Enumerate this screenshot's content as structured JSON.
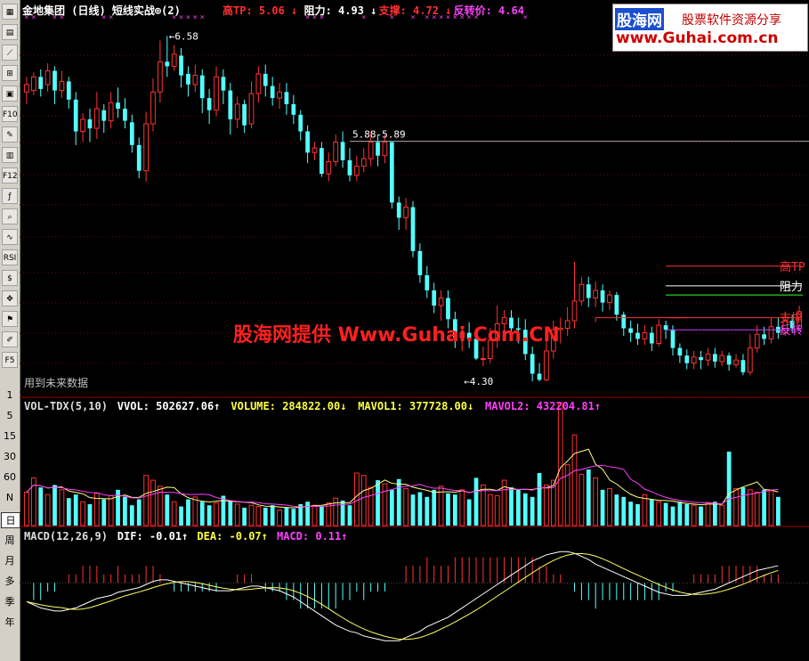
{
  "header": {
    "title": "金地集团 (日线) 短线实战⊕(2)",
    "items": [
      {
        "label": "高TP: 5.06 ↓",
        "color": "#ff3030"
      },
      {
        "label": "阻力: 4.93 ↓",
        "color": "#ffffff"
      },
      {
        "label": "支撑: 4.72 ↓",
        "color": "#ff3030"
      },
      {
        "label": "反转价: 4.64",
        "color": "#ff40ff"
      }
    ]
  },
  "logo": {
    "brand": "股海网",
    "slogan": "股票软件资源分享",
    "url": "www.Guhai.com.cn"
  },
  "watermark": "股海网提供 Www.Guhai.Com.CN",
  "notice": "用到未来数据",
  "price_panel": {
    "annotations": {
      "high": "6.58",
      "range": "5.88-5.89",
      "low": "←4.30"
    },
    "right_labels": {
      "high_tp": "高TP",
      "resistance": "阻力",
      "support": "支撑",
      "reversal": "反转"
    }
  },
  "volume_panel": {
    "header_items": [
      {
        "label": "VOL-TDX(5,10)",
        "color": "#dddddd"
      },
      {
        "label": "VVOL: 502627.06↑",
        "color": "#ffffff"
      },
      {
        "label": "VOLUME: 284822.00↓",
        "color": "#ffff40"
      },
      {
        "label": "MAVOL1: 377728.00↓",
        "color": "#ffff40"
      },
      {
        "label": "MAVOL2: 432204.81↑",
        "color": "#ff40ff"
      }
    ]
  },
  "macd_panel": {
    "header_items": [
      {
        "label": "MACD(12,26,9)",
        "color": "#dddddd"
      },
      {
        "label": "DIF: -0.01↑",
        "color": "#ffffff"
      },
      {
        "label": "DEA: -0.07↑",
        "color": "#ffff40"
      },
      {
        "label": "MACD: 0.11↑",
        "color": "#ff40ff"
      }
    ]
  },
  "toolbar": {
    "icons": [
      "grid-icon",
      "table-icon",
      "line-chart-icon",
      "candle-icon",
      "window-icon",
      "f10-icon",
      "pen-icon",
      "sheet-icon",
      "f12-icon",
      "fx-icon",
      "search-icon",
      "wave-icon",
      "rsi-icon",
      "dollar-icon",
      "move-icon",
      "flag-icon",
      "pencil-icon",
      "f5-icon"
    ],
    "labels": {
      "rsi": "RSI",
      "f10": "F10",
      "f12": "F12",
      "f5": "F5"
    },
    "periods": [
      "1",
      "5",
      "15",
      "30",
      "60",
      "N",
      "日",
      "周",
      "月",
      "多",
      "季",
      "年"
    ]
  },
  "colors": {
    "up": "#ff3232",
    "down": "#54ffff",
    "background": "#000000"
  },
  "chart_data": [
    {
      "type": "candlestick",
      "ylim": [
        4.2,
        6.7
      ],
      "annotated_high": 6.58,
      "annotated_low": 4.3,
      "levels": {
        "high_tp": 5.06,
        "resistance": 4.93,
        "support": 4.72,
        "reversal": 4.64
      },
      "candles": [
        [
          6.21,
          6.26,
          6.31,
          6.13
        ],
        [
          6.22,
          6.31,
          6.34,
          6.19
        ],
        [
          6.31,
          6.23,
          6.36,
          6.18
        ],
        [
          6.26,
          6.35,
          6.4,
          6.21
        ],
        [
          6.35,
          6.22,
          6.38,
          6.13
        ],
        [
          6.22,
          6.28,
          6.35,
          6.17
        ],
        [
          6.28,
          6.16,
          6.31,
          6.1
        ],
        [
          6.16,
          5.95,
          6.21,
          5.86
        ],
        [
          5.95,
          6.03,
          6.07,
          5.88
        ],
        [
          6.03,
          5.97,
          6.1,
          5.88
        ],
        [
          5.97,
          6.1,
          6.21,
          5.9
        ],
        [
          6.09,
          6.02,
          6.13,
          5.94
        ],
        [
          6.02,
          6.14,
          6.21,
          5.97
        ],
        [
          6.14,
          6.1,
          6.24,
          6.04
        ],
        [
          6.1,
          6.02,
          6.17,
          5.97
        ],
        [
          6.01,
          5.86,
          6.06,
          5.81
        ],
        [
          5.86,
          5.69,
          5.91,
          5.64
        ],
        [
          5.69,
          6.0,
          6.08,
          5.62
        ],
        [
          6.0,
          6.21,
          6.3,
          5.95
        ],
        [
          6.21,
          6.41,
          6.55,
          6.14
        ],
        [
          6.41,
          6.38,
          6.58,
          6.31
        ],
        [
          6.38,
          6.46,
          6.52,
          6.35
        ],
        [
          6.45,
          6.32,
          6.5,
          6.24
        ],
        [
          6.33,
          6.26,
          6.38,
          6.18
        ],
        [
          6.26,
          6.32,
          6.39,
          6.21
        ],
        [
          6.32,
          6.17,
          6.36,
          6.07
        ],
        [
          6.17,
          6.09,
          6.23,
          6.0
        ],
        [
          6.09,
          6.31,
          6.38,
          6.05
        ],
        [
          6.31,
          6.22,
          6.36,
          6.13
        ],
        [
          6.22,
          6.03,
          6.27,
          5.93
        ],
        [
          6.03,
          6.13,
          6.18,
          5.97
        ],
        [
          6.13,
          5.99,
          6.16,
          5.94
        ],
        [
          6.0,
          6.2,
          6.28,
          5.97
        ],
        [
          6.2,
          6.33,
          6.38,
          6.14
        ],
        [
          6.33,
          6.25,
          6.39,
          6.18
        ],
        [
          6.25,
          6.17,
          6.31,
          6.12
        ],
        [
          6.17,
          6.21,
          6.27,
          6.1
        ],
        [
          6.21,
          6.13,
          6.27,
          6.06
        ],
        [
          6.13,
          6.06,
          6.19,
          6.0
        ],
        [
          6.06,
          5.95,
          6.09,
          5.89
        ],
        [
          5.95,
          5.81,
          5.99,
          5.74
        ],
        [
          5.81,
          5.84,
          5.88,
          5.76
        ],
        [
          5.84,
          5.67,
          5.88,
          5.65
        ],
        [
          5.67,
          5.75,
          5.81,
          5.62
        ],
        [
          5.75,
          5.88,
          5.93,
          5.72
        ],
        [
          5.88,
          5.76,
          5.95,
          5.71
        ],
        [
          5.76,
          5.66,
          5.84,
          5.62
        ],
        [
          5.66,
          5.72,
          5.79,
          5.62
        ],
        [
          5.72,
          5.77,
          5.84,
          5.68
        ],
        [
          5.77,
          5.88,
          5.95,
          5.72
        ],
        [
          5.88,
          5.79,
          5.93,
          5.72
        ],
        [
          5.79,
          5.88,
          5.93,
          5.74
        ],
        [
          5.88,
          5.48,
          5.88,
          5.44
        ],
        [
          5.48,
          5.38,
          5.52,
          5.3
        ],
        [
          5.38,
          5.45,
          5.51,
          5.3
        ],
        [
          5.45,
          5.16,
          5.49,
          5.12
        ],
        [
          5.16,
          5.0,
          5.21,
          4.95
        ],
        [
          5.0,
          4.9,
          5.06,
          4.85
        ],
        [
          4.9,
          4.8,
          4.95,
          4.75
        ],
        [
          4.8,
          4.85,
          4.9,
          4.7
        ],
        [
          4.85,
          4.71,
          4.9,
          4.65
        ],
        [
          4.71,
          4.59,
          4.76,
          4.52
        ],
        [
          4.59,
          4.62,
          4.65,
          4.5
        ],
        [
          4.62,
          4.58,
          4.69,
          4.52
        ],
        [
          4.58,
          4.45,
          4.63,
          4.44
        ],
        [
          4.45,
          4.45,
          4.53,
          4.4
        ],
        [
          4.45,
          4.57,
          4.65,
          4.42
        ],
        [
          4.57,
          4.68,
          4.8,
          4.52
        ],
        [
          4.68,
          4.72,
          4.77,
          4.6
        ],
        [
          4.72,
          4.65,
          4.77,
          4.6
        ],
        [
          4.65,
          4.64,
          4.72,
          4.55
        ],
        [
          4.64,
          4.48,
          4.71,
          4.44
        ],
        [
          4.48,
          4.35,
          4.53,
          4.3
        ],
        [
          4.35,
          4.31,
          4.42,
          4.3
        ],
        [
          4.31,
          4.5,
          4.58,
          4.3
        ],
        [
          4.5,
          4.64,
          4.7,
          4.45
        ],
        [
          4.64,
          4.65,
          4.72,
          4.55
        ],
        [
          4.65,
          4.7,
          4.79,
          4.6
        ],
        [
          4.7,
          4.83,
          5.09,
          4.65
        ],
        [
          4.83,
          4.94,
          4.99,
          4.8
        ],
        [
          4.94,
          4.85,
          4.99,
          4.79
        ],
        [
          4.85,
          4.9,
          4.96,
          4.79
        ],
        [
          4.9,
          4.82,
          4.94,
          4.76
        ],
        [
          4.82,
          4.87,
          4.9,
          4.77
        ],
        [
          4.87,
          4.74,
          4.89,
          4.7
        ],
        [
          4.74,
          4.65,
          4.76,
          4.6
        ],
        [
          4.65,
          4.62,
          4.7,
          4.56
        ],
        [
          4.62,
          4.58,
          4.68,
          4.54
        ],
        [
          4.58,
          4.62,
          4.67,
          4.54
        ],
        [
          4.62,
          4.55,
          4.66,
          4.5
        ],
        [
          4.55,
          4.67,
          4.71,
          4.53
        ],
        [
          4.67,
          4.64,
          4.7,
          4.58
        ],
        [
          4.64,
          4.52,
          4.67,
          4.47
        ],
        [
          4.52,
          4.47,
          4.55,
          4.42
        ],
        [
          4.47,
          4.42,
          4.51,
          4.38
        ],
        [
          4.42,
          4.46,
          4.5,
          4.38
        ],
        [
          4.46,
          4.44,
          4.5,
          4.38
        ],
        [
          4.44,
          4.48,
          4.52,
          4.4
        ],
        [
          4.48,
          4.43,
          4.52,
          4.39
        ],
        [
          4.43,
          4.47,
          4.5,
          4.4
        ],
        [
          4.47,
          4.41,
          4.49,
          4.37
        ],
        [
          4.41,
          4.44,
          4.48,
          4.39
        ],
        [
          4.44,
          4.36,
          4.48,
          4.34
        ],
        [
          4.36,
          4.52,
          4.61,
          4.34
        ],
        [
          4.52,
          4.61,
          4.67,
          4.49
        ],
        [
          4.61,
          4.58,
          4.66,
          4.54
        ],
        [
          4.58,
          4.66,
          4.72,
          4.55
        ],
        [
          4.66,
          4.62,
          4.72,
          4.58
        ],
        [
          4.62,
          4.7,
          4.76,
          4.6
        ],
        [
          4.7,
          4.65,
          4.74,
          4.62
        ],
        [
          4.65,
          4.76,
          4.8,
          4.64
        ]
      ]
    },
    {
      "type": "bar",
      "name": "volume",
      "ylim": [
        0,
        1000000
      ],
      "values": [
        280000,
        400000,
        320000,
        260000,
        340000,
        300000,
        230000,
        260000,
        200000,
        180000,
        270000,
        220000,
        250000,
        300000,
        240000,
        170000,
        220000,
        420000,
        380000,
        330000,
        260000,
        200000,
        160000,
        220000,
        240000,
        200000,
        170000,
        190000,
        250000,
        210000,
        180000,
        150000,
        170000,
        160000,
        150000,
        170000,
        130000,
        150000,
        140000,
        180000,
        200000,
        170000,
        160000,
        190000,
        230000,
        210000,
        170000,
        440000,
        420000,
        320000,
        380000,
        350000,
        300000,
        390000,
        310000,
        260000,
        280000,
        240000,
        300000,
        330000,
        270000,
        260000,
        300000,
        220000,
        400000,
        340000,
        260000,
        250000,
        380000,
        320000,
        300000,
        270000,
        240000,
        440000,
        340000,
        380000,
        1030000,
        510000,
        760000,
        430000,
        470000,
        400000,
        300000,
        310000,
        260000,
        240000,
        200000,
        180000,
        260000,
        220000,
        200000,
        190000,
        160000,
        200000,
        180000,
        170000,
        160000,
        190000,
        200000,
        170000,
        620000,
        310000,
        320000,
        300000,
        280000,
        300000,
        290000,
        240000
      ],
      "mavol1_last": 377728.0,
      "mavol2_last": 432204.81
    },
    {
      "type": "bar",
      "name": "macd",
      "ylim": [
        -0.5,
        0.35
      ],
      "values": [
        -0.12,
        -0.14,
        -0.16,
        -0.17,
        -0.18,
        -0.18,
        -0.17,
        -0.16,
        -0.14,
        -0.12,
        -0.1,
        -0.09,
        -0.08,
        -0.06,
        -0.05,
        -0.04,
        -0.03,
        -0.01,
        0.01,
        0.02,
        0.02,
        0.01,
        0.0,
        -0.01,
        -0.02,
        -0.03,
        -0.04,
        -0.05,
        -0.05,
        -0.05,
        -0.04,
        -0.03,
        -0.02,
        -0.02,
        -0.03,
        -0.04,
        -0.05,
        -0.07,
        -0.09,
        -0.12,
        -0.15,
        -0.18,
        -0.21,
        -0.24,
        -0.27,
        -0.29,
        -0.31,
        -0.32,
        -0.34,
        -0.35,
        -0.36,
        -0.37,
        -0.37,
        -0.37,
        -0.35,
        -0.33,
        -0.31,
        -0.28,
        -0.26,
        -0.24,
        -0.22,
        -0.19,
        -0.16,
        -0.13,
        -0.1,
        -0.07,
        -0.04,
        -0.01,
        0.02,
        0.05,
        0.08,
        0.11,
        0.14,
        0.16,
        0.18,
        0.19,
        0.2,
        0.2,
        0.19,
        0.17,
        0.15,
        0.12,
        0.1,
        0.08,
        0.06,
        0.04,
        0.02,
        0.0,
        -0.02,
        -0.04,
        -0.06,
        -0.07,
        -0.08,
        -0.08,
        -0.08,
        -0.07,
        -0.06,
        -0.05,
        -0.04,
        -0.02,
        0.0,
        0.02,
        0.04,
        0.06,
        0.08,
        0.09,
        0.1,
        0.11
      ],
      "dif_last": -0.01,
      "dea_last": -0.07
    }
  ]
}
